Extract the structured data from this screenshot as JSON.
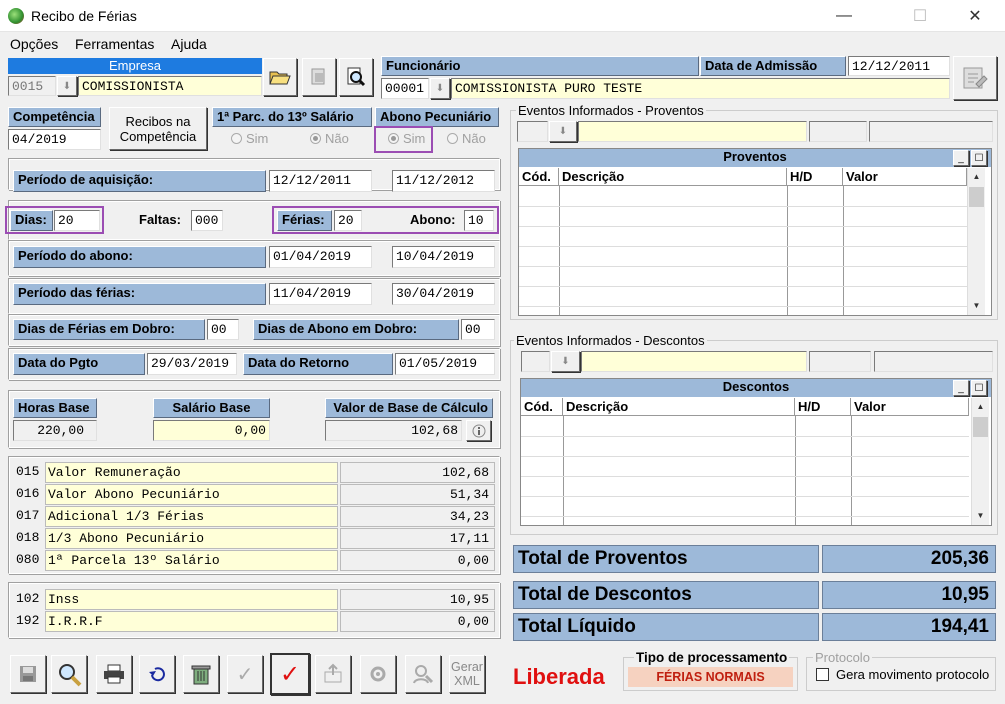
{
  "window": {
    "title": "Recibo de Férias",
    "minimize": "—",
    "maximize": "☐",
    "close": "✕"
  },
  "menu": [
    "Opções",
    "Ferramentas",
    "Ajuda"
  ],
  "empresa": {
    "label": "Empresa",
    "code": "0015",
    "name": "COMISSIONISTA"
  },
  "funcionario": {
    "label": "Funcionário",
    "code": "00001",
    "name": "COMISSIONISTA PURO TESTE"
  },
  "admissao": {
    "label": "Data de Admissão",
    "value": "12/12/2011"
  },
  "competencia": {
    "label": "Competência",
    "value": "04/2019",
    "button": "Recibos na\nCompetência"
  },
  "parc13": {
    "label": "1ª Parc. do 13º Salário",
    "sim": "Sim",
    "nao": "Não"
  },
  "abono_pec": {
    "label": "Abono Pecuniário",
    "sim": "Sim",
    "nao": "Não"
  },
  "periodo_aquisicao": {
    "label": "Período de aquisição:",
    "start": "12/12/2011",
    "end": "11/12/2012"
  },
  "dias": {
    "label": "Dias:",
    "value": "20"
  },
  "faltas": {
    "label": "Faltas:",
    "value": "000"
  },
  "ferias": {
    "label": "Férias:",
    "value": "20"
  },
  "abono": {
    "label": "Abono:",
    "value": "10"
  },
  "periodo_abono": {
    "label": "Período do abono:",
    "start": "01/04/2019",
    "end": "10/04/2019"
  },
  "periodo_ferias": {
    "label": "Período das férias:",
    "start": "11/04/2019",
    "end": "30/04/2019"
  },
  "dias_ferias_dobro": {
    "label": "Dias de Férias em Dobro:",
    "value": "00"
  },
  "dias_abono_dobro": {
    "label": "Dias de Abono em Dobro:",
    "value": "00"
  },
  "data_pgto": {
    "label": "Data do Pgto",
    "value": "29/03/2019"
  },
  "data_retorno": {
    "label": "Data do Retorno",
    "value": "01/05/2019"
  },
  "horas_base": {
    "label": "Horas Base",
    "value": "220,00"
  },
  "salario_base": {
    "label": "Salário Base",
    "value": "0,00"
  },
  "valor_base": {
    "label": "Valor de Base de Cálculo",
    "value": "102,68"
  },
  "proventos_list": [
    {
      "code": "015",
      "desc": "Valor Remuneração",
      "value": "102,68"
    },
    {
      "code": "016",
      "desc": "Valor Abono Pecuniário",
      "value": "51,34"
    },
    {
      "code": "017",
      "desc": "Adicional 1/3 Férias",
      "value": "34,23"
    },
    {
      "code": "018",
      "desc": "1/3 Abono Pecuniário",
      "value": "17,11"
    },
    {
      "code": "080",
      "desc": "1ª Parcela 13º Salário",
      "value": "0,00"
    }
  ],
  "descontos_list": [
    {
      "code": "102",
      "desc": "Inss",
      "value": "10,95"
    },
    {
      "code": "192",
      "desc": "I.R.R.F",
      "value": "0,00"
    }
  ],
  "eventos_proventos": {
    "legend": "Eventos Informados - Proventos",
    "title": "Proventos",
    "cols": [
      "Cód.",
      "Descrição",
      "H/D",
      "Valor"
    ]
  },
  "eventos_descontos": {
    "legend": "Eventos Informados - Descontos",
    "title": "Descontos",
    "cols": [
      "Cód.",
      "Descrição",
      "H/D",
      "Valor"
    ]
  },
  "totals": {
    "proventos_label": "Total de Proventos",
    "proventos_value": "205,36",
    "descontos_label": "Total de Descontos",
    "descontos_value": "10,95",
    "liquido_label": "Total Líquido",
    "liquido_value": "194,41"
  },
  "status": {
    "text": "Liberada",
    "color": "#e01010"
  },
  "tipo_processamento": {
    "label": "Tipo de processamento",
    "value": "FÉRIAS NORMAIS"
  },
  "protocolo": {
    "label": "Protocolo",
    "checkbox": "Gera movimento protocolo"
  },
  "toolbar": {
    "gerar_xml": "Gerar\nXML"
  }
}
